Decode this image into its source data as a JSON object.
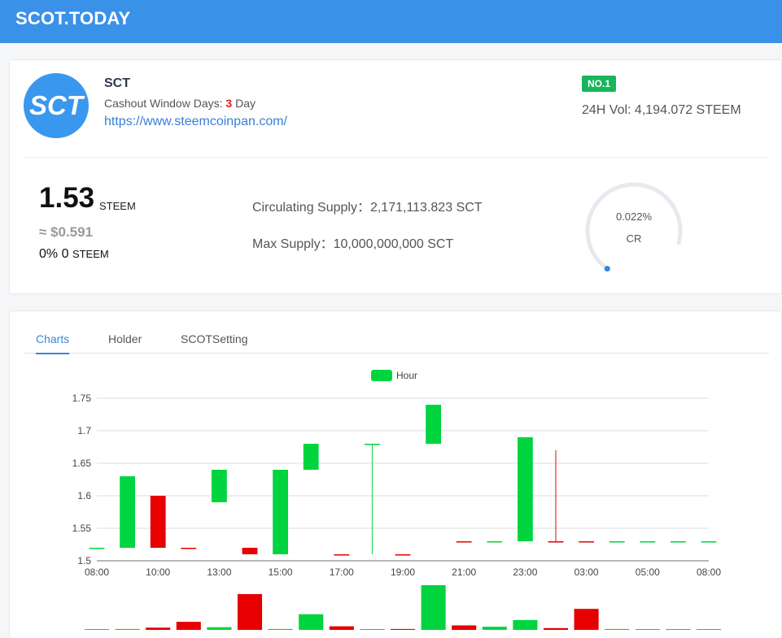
{
  "header": {
    "brand": "SCOT.TODAY"
  },
  "token": {
    "logo_text": "SCT",
    "name": "SCT",
    "cashout_label": "Cashout Window Days:",
    "cashout_days": "3",
    "cashout_unit": "Day",
    "url": "https://www.steemcoinpan.com/",
    "rank_badge": "NO.1",
    "volume_24h": "24H Vol: 4,194.072 STEEM",
    "price": "1.53",
    "price_unit": "STEEM",
    "usd_price": "≈ $0.591",
    "change_pct": "0%",
    "change_value": "0",
    "change_unit": "STEEM",
    "circulating_supply": "Circulating Supply：2,171,113.823 SCT",
    "max_supply": "Max Supply：10,000,000,000 SCT",
    "cr_pct": "0.022%",
    "cr_label": "CR",
    "cr_fraction": 0.00022
  },
  "tabs": [
    "Charts",
    "Holder",
    "SCOTSetting"
  ],
  "active_tab": "Charts",
  "colors": {
    "up": "#00d53f",
    "down": "#e60000",
    "accent": "#3a91e8",
    "badge": "#19b55a"
  },
  "chart_data": {
    "type": "candlestick",
    "legend": "Hour",
    "ylim": [
      1.5,
      1.75
    ],
    "y_ticks": [
      "1.75",
      "1.7",
      "1.65",
      "1.6",
      "1.55",
      "1.5"
    ],
    "x_ticks": [
      "08:00",
      "10:00",
      "13:00",
      "15:00",
      "17:00",
      "19:00",
      "21:00",
      "23:00",
      "03:00",
      "05:00",
      "08:00"
    ],
    "candles": [
      {
        "open": 1.52,
        "close": 1.52,
        "high": 1.52,
        "low": 1.52,
        "volume": 0
      },
      {
        "open": 1.52,
        "close": 1.63,
        "high": 1.63,
        "low": 1.52,
        "volume": 0.02
      },
      {
        "open": 1.6,
        "close": 1.52,
        "high": 1.6,
        "low": 1.52,
        "volume": 0.05
      },
      {
        "open": 1.52,
        "close": 1.52,
        "high": 1.52,
        "low": 1.52,
        "volume": 0.18
      },
      {
        "open": 1.59,
        "close": 1.64,
        "high": 1.64,
        "low": 1.59,
        "volume": 0.06
      },
      {
        "open": 1.52,
        "close": 1.51,
        "high": 1.52,
        "low": 1.51,
        "volume": 0.8
      },
      {
        "open": 1.51,
        "close": 1.64,
        "high": 1.64,
        "low": 1.51,
        "volume": 0.02
      },
      {
        "open": 1.64,
        "close": 1.68,
        "high": 1.68,
        "low": 1.64,
        "volume": 0.35
      },
      {
        "open": 1.51,
        "close": 1.51,
        "high": 1.51,
        "low": 1.51,
        "volume": 0.08
      },
      {
        "open": 1.68,
        "close": 1.68,
        "high": 1.68,
        "low": 1.51,
        "volume": 0.01
      },
      {
        "open": 1.51,
        "close": 1.51,
        "high": 1.51,
        "low": 1.51,
        "volume": 0.02
      },
      {
        "open": 1.68,
        "close": 1.74,
        "high": 1.74,
        "low": 1.68,
        "volume": 1.0
      },
      {
        "open": 1.53,
        "close": 1.53,
        "high": 1.53,
        "low": 1.53,
        "volume": 0.1
      },
      {
        "open": 1.53,
        "close": 1.53,
        "high": 1.53,
        "low": 1.53,
        "volume": 0.07
      },
      {
        "open": 1.53,
        "close": 1.69,
        "high": 1.69,
        "low": 1.53,
        "volume": 0.22
      },
      {
        "open": 1.53,
        "close": 1.53,
        "high": 1.67,
        "low": 1.53,
        "volume": 0.04
      },
      {
        "open": 1.53,
        "close": 1.53,
        "high": 1.53,
        "low": 1.53,
        "volume": 0.47
      },
      {
        "open": 1.53,
        "close": 1.53,
        "high": 1.53,
        "low": 1.53,
        "volume": 0.02
      },
      {
        "open": 1.53,
        "close": 1.53,
        "high": 1.53,
        "low": 1.53,
        "volume": 0.01
      },
      {
        "open": 1.53,
        "close": 1.53,
        "high": 1.53,
        "low": 1.53,
        "volume": 0
      },
      {
        "open": 1.53,
        "close": 1.53,
        "high": 1.53,
        "low": 1.53,
        "volume": 0
      }
    ],
    "candle_colors": [
      "up",
      "up",
      "down",
      "down",
      "up",
      "down",
      "up",
      "up",
      "down",
      "up",
      "down",
      "up",
      "down",
      "up",
      "up",
      "down",
      "down",
      "up",
      "up",
      "up",
      "up"
    ]
  }
}
